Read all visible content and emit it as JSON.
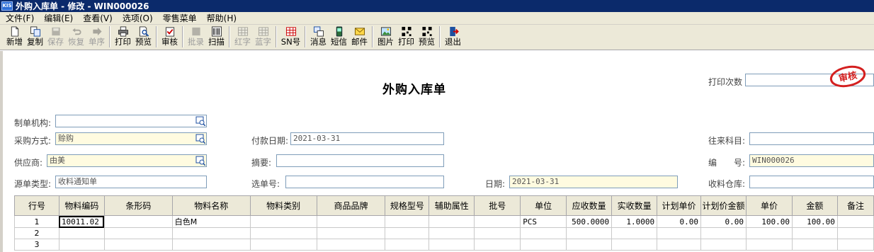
{
  "window": {
    "title": "外购入库单 - 修改 - WIN000026",
    "logo_text": "KIS"
  },
  "menu": [
    "文件(F)",
    "编辑(E)",
    "查看(V)",
    "选项(O)",
    "零售菜单",
    "帮助(H)"
  ],
  "toolbar": {
    "new": "新增",
    "copy": "复制",
    "save": "保存",
    "restore": "恢复",
    "single": "单序",
    "print": "打印",
    "preview": "预览",
    "audit": "审核",
    "batch": "批录",
    "scan": "扫描",
    "red": "红字",
    "blue": "蓝字",
    "sn": "SN号",
    "message": "消息",
    "sms": "短信",
    "mail": "邮件",
    "picture": "图片",
    "print2": "打印",
    "preview2": "预览",
    "exit": "退出"
  },
  "form": {
    "title": "外购入库单",
    "print_count_label": "打印次数",
    "print_count_value": "",
    "stamp_text": "审核",
    "org_label": "制单机构:",
    "org_value": "",
    "purchase_method_label": "采购方式:",
    "purchase_method_value": "赊购",
    "pay_date_label": "付款日期:",
    "pay_date_value": "2021-03-31",
    "account_label": "往来科目:",
    "account_value": "",
    "supplier_label": "供应商:",
    "supplier_value": "由美",
    "summary_label": "摘要:",
    "summary_value": "",
    "number_label": "编　　号:",
    "number_value": "WIN000026",
    "source_type_label": "源单类型:",
    "source_type_value": "收料通知单",
    "select_no_label": "选单号:",
    "select_no_value": "",
    "date_label": "日期:",
    "date_value": "2021-03-31",
    "warehouse_label": "收料仓库:",
    "warehouse_value": ""
  },
  "grid": {
    "headers": [
      "行号",
      "物料编码",
      "条形码",
      "物料名称",
      "物料类别",
      "商品品牌",
      "规格型号",
      "辅助属性",
      "批号",
      "单位",
      "应收数量",
      "实收数量",
      "计划单价",
      "计划价金额",
      "单价",
      "金额",
      "备注"
    ],
    "rows": [
      [
        "1",
        "10011.02",
        "",
        "白色M",
        "",
        "",
        "",
        "",
        "",
        "PCS",
        "500.0000",
        "1.0000",
        "0.00",
        "0.00",
        "100.00",
        "100.00",
        ""
      ],
      [
        "2",
        "",
        "",
        "",
        "",
        "",
        "",
        "",
        "",
        "",
        "",
        "",
        "",
        "",
        "",
        "",
        ""
      ],
      [
        "3",
        "",
        "",
        "",
        "",
        "",
        "",
        "",
        "",
        "",
        "",
        "",
        "",
        "",
        "",
        "",
        ""
      ]
    ]
  },
  "colors": {
    "titlebar": "#0b2a6b",
    "stamp": "#d42020",
    "field_yellow": "#fffbe0"
  }
}
